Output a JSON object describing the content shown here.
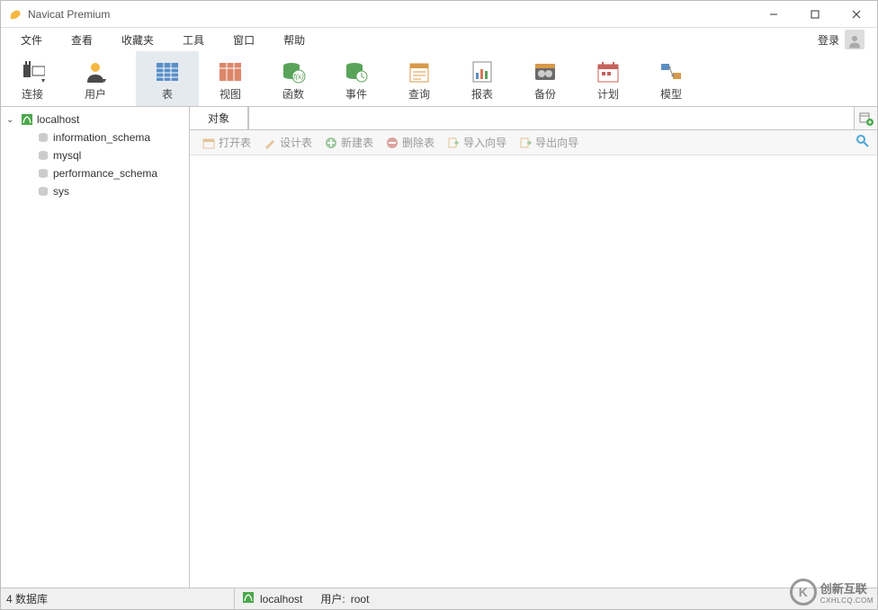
{
  "window": {
    "title": "Navicat Premium"
  },
  "menubar": {
    "items": [
      "文件",
      "查看",
      "收藏夹",
      "工具",
      "窗口",
      "帮助"
    ],
    "login": "登录"
  },
  "toolbar": {
    "items": [
      {
        "label": "连接",
        "key": "connection"
      },
      {
        "label": "用户",
        "key": "user"
      },
      {
        "label": "表",
        "key": "table",
        "active": true
      },
      {
        "label": "视图",
        "key": "view"
      },
      {
        "label": "函数",
        "key": "function"
      },
      {
        "label": "事件",
        "key": "event"
      },
      {
        "label": "查询",
        "key": "query"
      },
      {
        "label": "报表",
        "key": "report"
      },
      {
        "label": "备份",
        "key": "backup"
      },
      {
        "label": "计划",
        "key": "schedule"
      },
      {
        "label": "模型",
        "key": "model"
      }
    ]
  },
  "sidebar": {
    "connection": {
      "label": "localhost"
    },
    "databases": [
      {
        "label": "information_schema"
      },
      {
        "label": "mysql"
      },
      {
        "label": "performance_schema"
      },
      {
        "label": "sys"
      }
    ]
  },
  "tabs": {
    "active": "对象",
    "search_placeholder": ""
  },
  "objectToolbar": {
    "items": [
      "打开表",
      "设计表",
      "新建表",
      "删除表",
      "导入向导",
      "导出向导"
    ]
  },
  "statusbar": {
    "left": "4 数据库",
    "conn": "localhost",
    "user_label": "用户:",
    "user": "root"
  },
  "watermark": {
    "brand": "创新互联",
    "sub": "CXHLCQ.COM"
  }
}
